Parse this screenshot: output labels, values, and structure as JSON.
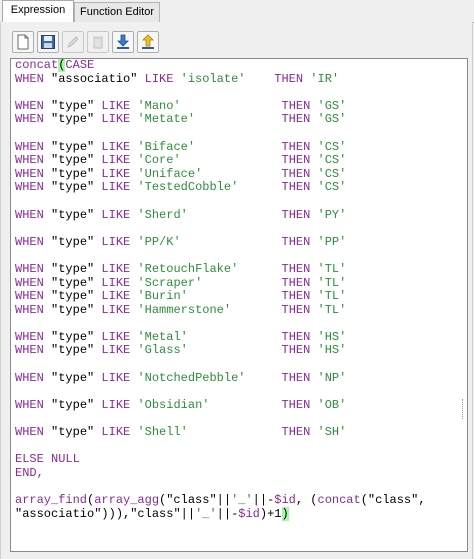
{
  "tabs": [
    {
      "label": "Expression",
      "active": true
    },
    {
      "label": "Function Editor",
      "active": false
    }
  ],
  "toolbar": [
    {
      "name": "new-file-icon",
      "enabled": true
    },
    {
      "name": "save-icon",
      "enabled": true
    },
    {
      "name": "edit-icon",
      "enabled": false
    },
    {
      "name": "delete-icon",
      "enabled": false
    },
    {
      "name": "import-icon",
      "enabled": true
    },
    {
      "name": "export-icon",
      "enabled": true
    }
  ],
  "colors": {
    "keyword": "#8a2a9a",
    "string": "#2d8f3a",
    "bracket_highlight": "#a9f6a9"
  },
  "code_lines": [
    [
      {
        "t": "concat",
        "c": "fn"
      },
      {
        "t": "(",
        "c": "hl"
      },
      {
        "t": "CASE",
        "c": "kw"
      }
    ],
    [
      {
        "t": "WHEN ",
        "c": "kw"
      },
      {
        "t": "\"associatio\"",
        "c": "pa"
      },
      {
        "t": " LIKE ",
        "c": "kw"
      },
      {
        "t": "'isolate'",
        "c": "st"
      },
      {
        "t": "    ",
        "c": "pa"
      },
      {
        "t": "THEN ",
        "c": "kw"
      },
      {
        "t": "'IR'",
        "c": "st"
      }
    ],
    [],
    [
      {
        "t": "WHEN ",
        "c": "kw"
      },
      {
        "t": "\"type\"",
        "c": "pa"
      },
      {
        "t": " LIKE ",
        "c": "kw"
      },
      {
        "t": "'Mano'",
        "c": "st"
      },
      {
        "t": "              ",
        "c": "pa"
      },
      {
        "t": "THEN ",
        "c": "kw"
      },
      {
        "t": "'GS'",
        "c": "st"
      }
    ],
    [
      {
        "t": "WHEN ",
        "c": "kw"
      },
      {
        "t": "\"type\"",
        "c": "pa"
      },
      {
        "t": " LIKE ",
        "c": "kw"
      },
      {
        "t": "'Metate'",
        "c": "st"
      },
      {
        "t": "            ",
        "c": "pa"
      },
      {
        "t": "THEN ",
        "c": "kw"
      },
      {
        "t": "'GS'",
        "c": "st"
      }
    ],
    [],
    [
      {
        "t": "WHEN ",
        "c": "kw"
      },
      {
        "t": "\"type\"",
        "c": "pa"
      },
      {
        "t": " LIKE ",
        "c": "kw"
      },
      {
        "t": "'Biface'",
        "c": "st"
      },
      {
        "t": "            ",
        "c": "pa"
      },
      {
        "t": "THEN ",
        "c": "kw"
      },
      {
        "t": "'CS'",
        "c": "st"
      }
    ],
    [
      {
        "t": "WHEN ",
        "c": "kw"
      },
      {
        "t": "\"type\"",
        "c": "pa"
      },
      {
        "t": " LIKE ",
        "c": "kw"
      },
      {
        "t": "'Core'",
        "c": "st"
      },
      {
        "t": "              ",
        "c": "pa"
      },
      {
        "t": "THEN ",
        "c": "kw"
      },
      {
        "t": "'CS'",
        "c": "st"
      }
    ],
    [
      {
        "t": "WHEN ",
        "c": "kw"
      },
      {
        "t": "\"type\"",
        "c": "pa"
      },
      {
        "t": " LIKE ",
        "c": "kw"
      },
      {
        "t": "'Uniface'",
        "c": "st"
      },
      {
        "t": "           ",
        "c": "pa"
      },
      {
        "t": "THEN ",
        "c": "kw"
      },
      {
        "t": "'CS'",
        "c": "st"
      }
    ],
    [
      {
        "t": "WHEN ",
        "c": "kw"
      },
      {
        "t": "\"type\"",
        "c": "pa"
      },
      {
        "t": " LIKE ",
        "c": "kw"
      },
      {
        "t": "'TestedCobble'",
        "c": "st"
      },
      {
        "t": "      ",
        "c": "pa"
      },
      {
        "t": "THEN ",
        "c": "kw"
      },
      {
        "t": "'CS'",
        "c": "st"
      }
    ],
    [],
    [
      {
        "t": "WHEN ",
        "c": "kw"
      },
      {
        "t": "\"type\"",
        "c": "pa"
      },
      {
        "t": " LIKE ",
        "c": "kw"
      },
      {
        "t": "'Sherd'",
        "c": "st"
      },
      {
        "t": "             ",
        "c": "pa"
      },
      {
        "t": "THEN ",
        "c": "kw"
      },
      {
        "t": "'PY'",
        "c": "st"
      }
    ],
    [],
    [
      {
        "t": "WHEN ",
        "c": "kw"
      },
      {
        "t": "\"type\"",
        "c": "pa"
      },
      {
        "t": " LIKE ",
        "c": "kw"
      },
      {
        "t": "'PP/K'",
        "c": "st"
      },
      {
        "t": "              ",
        "c": "pa"
      },
      {
        "t": "THEN ",
        "c": "kw"
      },
      {
        "t": "'PP'",
        "c": "st"
      }
    ],
    [],
    [
      {
        "t": "WHEN ",
        "c": "kw"
      },
      {
        "t": "\"type\"",
        "c": "pa"
      },
      {
        "t": " LIKE ",
        "c": "kw"
      },
      {
        "t": "'RetouchFlake'",
        "c": "st"
      },
      {
        "t": "      ",
        "c": "pa"
      },
      {
        "t": "THEN ",
        "c": "kw"
      },
      {
        "t": "'TL'",
        "c": "st"
      }
    ],
    [
      {
        "t": "WHEN ",
        "c": "kw"
      },
      {
        "t": "\"type\"",
        "c": "pa"
      },
      {
        "t": " LIKE ",
        "c": "kw"
      },
      {
        "t": "'Scraper'",
        "c": "st"
      },
      {
        "t": "           ",
        "c": "pa"
      },
      {
        "t": "THEN ",
        "c": "kw"
      },
      {
        "t": "'TL'",
        "c": "st"
      }
    ],
    [
      {
        "t": "WHEN ",
        "c": "kw"
      },
      {
        "t": "\"type\"",
        "c": "pa"
      },
      {
        "t": " LIKE ",
        "c": "kw"
      },
      {
        "t": "'Burin'",
        "c": "st"
      },
      {
        "t": "             ",
        "c": "pa"
      },
      {
        "t": "THEN ",
        "c": "kw"
      },
      {
        "t": "'TL'",
        "c": "st"
      }
    ],
    [
      {
        "t": "WHEN ",
        "c": "kw"
      },
      {
        "t": "\"type\"",
        "c": "pa"
      },
      {
        "t": " LIKE ",
        "c": "kw"
      },
      {
        "t": "'Hammerstone'",
        "c": "st"
      },
      {
        "t": "       ",
        "c": "pa"
      },
      {
        "t": "THEN ",
        "c": "kw"
      },
      {
        "t": "'TL'",
        "c": "st"
      }
    ],
    [],
    [
      {
        "t": "WHEN ",
        "c": "kw"
      },
      {
        "t": "\"type\"",
        "c": "pa"
      },
      {
        "t": " LIKE ",
        "c": "kw"
      },
      {
        "t": "'Metal'",
        "c": "st"
      },
      {
        "t": "             ",
        "c": "pa"
      },
      {
        "t": "THEN ",
        "c": "kw"
      },
      {
        "t": "'HS'",
        "c": "st"
      }
    ],
    [
      {
        "t": "WHEN ",
        "c": "kw"
      },
      {
        "t": "\"type\"",
        "c": "pa"
      },
      {
        "t": " LIKE ",
        "c": "kw"
      },
      {
        "t": "'Glass'",
        "c": "st"
      },
      {
        "t": "             ",
        "c": "pa"
      },
      {
        "t": "THEN ",
        "c": "kw"
      },
      {
        "t": "'HS'",
        "c": "st"
      }
    ],
    [],
    [
      {
        "t": "WHEN ",
        "c": "kw"
      },
      {
        "t": "\"type\"",
        "c": "pa"
      },
      {
        "t": " LIKE ",
        "c": "kw"
      },
      {
        "t": "'NotchedPebble'",
        "c": "st"
      },
      {
        "t": "     ",
        "c": "pa"
      },
      {
        "t": "THEN ",
        "c": "kw"
      },
      {
        "t": "'NP'",
        "c": "st"
      }
    ],
    [],
    [
      {
        "t": "WHEN ",
        "c": "kw"
      },
      {
        "t": "\"type\"",
        "c": "pa"
      },
      {
        "t": " LIKE ",
        "c": "kw"
      },
      {
        "t": "'Obsidian'",
        "c": "st"
      },
      {
        "t": "          ",
        "c": "pa"
      },
      {
        "t": "THEN ",
        "c": "kw"
      },
      {
        "t": "'OB'",
        "c": "st"
      }
    ],
    [],
    [
      {
        "t": "WHEN ",
        "c": "kw"
      },
      {
        "t": "\"type\"",
        "c": "pa"
      },
      {
        "t": " LIKE ",
        "c": "kw"
      },
      {
        "t": "'Shell'",
        "c": "st"
      },
      {
        "t": "             ",
        "c": "pa"
      },
      {
        "t": "THEN ",
        "c": "kw"
      },
      {
        "t": "'SH'",
        "c": "st"
      }
    ],
    [],
    [
      {
        "t": "ELSE NULL",
        "c": "kw"
      }
    ],
    [
      {
        "t": "END,",
        "c": "kw"
      }
    ],
    [],
    [
      {
        "t": "array_find",
        "c": "fn"
      },
      {
        "t": "(",
        "c": "pa"
      },
      {
        "t": "array_agg",
        "c": "fn"
      },
      {
        "t": "(",
        "c": "pa"
      },
      {
        "t": "\"class\"",
        "c": "pa"
      },
      {
        "t": "||",
        "c": "pa"
      },
      {
        "t": "'_'",
        "c": "st"
      },
      {
        "t": "||-",
        "c": "pa"
      },
      {
        "t": "$id",
        "c": "kw"
      },
      {
        "t": ", (",
        "c": "pa"
      },
      {
        "t": "concat",
        "c": "fn"
      },
      {
        "t": "(",
        "c": "pa"
      },
      {
        "t": "\"class\"",
        "c": "pa"
      },
      {
        "t": ",",
        "c": "pa"
      }
    ],
    [
      {
        "t": "\"associatio\"",
        "c": "pa"
      },
      {
        "t": "))),",
        "c": "pa"
      },
      {
        "t": "\"class\"",
        "c": "pa"
      },
      {
        "t": "||",
        "c": "pa"
      },
      {
        "t": "'_'",
        "c": "st"
      },
      {
        "t": "||-",
        "c": "pa"
      },
      {
        "t": "$id",
        "c": "kw"
      },
      {
        "t": ")+1",
        "c": "pa"
      },
      {
        "t": ")",
        "c": "hl"
      }
    ]
  ]
}
